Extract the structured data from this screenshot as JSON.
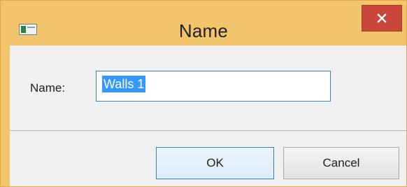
{
  "dialog": {
    "title": "Name",
    "name_label": "Name:",
    "name_value": "Walls 1",
    "ok_label": "OK",
    "cancel_label": "Cancel"
  },
  "icons": {
    "app": "app-window-icon",
    "close": "close-icon"
  },
  "colors": {
    "titlebar": "#f2c46c",
    "close_button": "#c9463a",
    "selection": "#3399ff",
    "input_border": "#3f7fbf",
    "client_background": "#f0f0f0"
  }
}
